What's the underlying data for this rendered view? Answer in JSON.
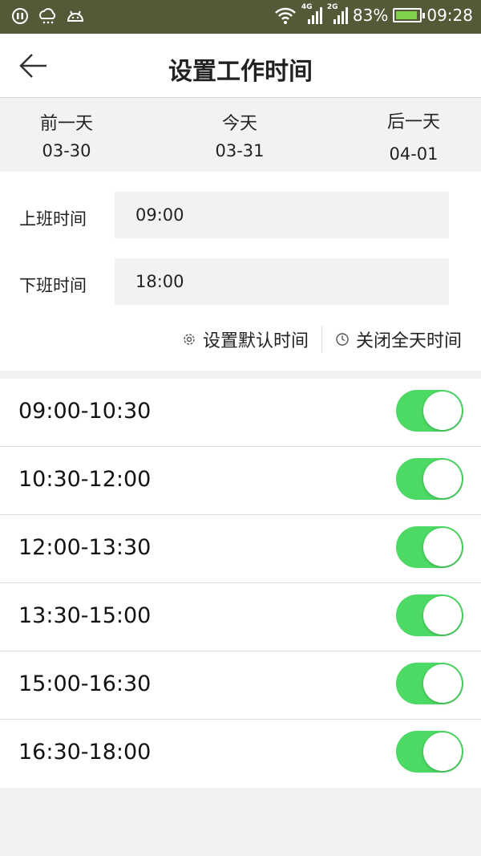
{
  "status_bar": {
    "network_4g": "4G",
    "network_2g": "2G",
    "battery_percent": "83%",
    "clock": "09:28",
    "icons": [
      "notification-icon",
      "weather-icon",
      "android-icon",
      "wifi-icon",
      "signal-4g-icon",
      "signal-2g-icon",
      "battery-charging-icon"
    ]
  },
  "header": {
    "title": "设置工作时间",
    "back_icon": "arrow-left-icon"
  },
  "days": {
    "prev": {
      "label": "前一天",
      "date": "03-30"
    },
    "today": {
      "label": "今天",
      "date": "03-31"
    },
    "next": {
      "label": "后一天",
      "date": "04-01"
    }
  },
  "work_time": {
    "start_label": "上班时间",
    "start_value": "09:00",
    "end_label": "下班时间",
    "end_value": "18:00",
    "set_default_label": "设置默认时间",
    "close_all_label": "关闭全天时间"
  },
  "slots": [
    {
      "time": "09:00-10:30",
      "enabled": true
    },
    {
      "time": "10:30-12:00",
      "enabled": true
    },
    {
      "time": "12:00-13:30",
      "enabled": true
    },
    {
      "time": "13:30-15:00",
      "enabled": true
    },
    {
      "time": "15:00-16:30",
      "enabled": true
    },
    {
      "time": "16:30-18:00",
      "enabled": true
    }
  ],
  "colors": {
    "status_bar_bg": "#545a38",
    "toggle_on": "#4cd964",
    "battery_fill": "#7fd14a"
  }
}
